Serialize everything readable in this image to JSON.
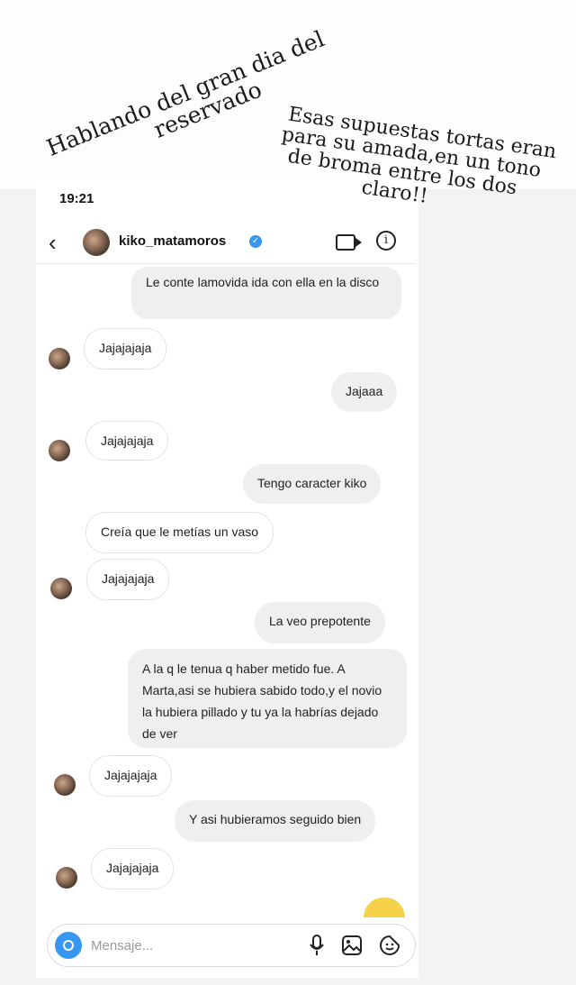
{
  "overlay": {
    "caption1": [
      "Hablando del gran dia del",
      "reservado"
    ],
    "caption2": [
      "Esas supuestas tortas eran",
      "para su amada,en un tono",
      "de broma entre los dos",
      "claro!!"
    ]
  },
  "status": {
    "time": "19:21"
  },
  "header": {
    "username": "kiko_matamoros",
    "verified_icon": "verified-check-icon",
    "video_icon": "video-camera-icon",
    "info_icon": "info-icon"
  },
  "messages": [
    {
      "from": "me",
      "text": "Le conte lamovida ida con ella en la disco"
    },
    {
      "from": "them",
      "text": "Jajajajaja"
    },
    {
      "from": "me",
      "text": "Jajaaa"
    },
    {
      "from": "them",
      "text": "Jajajajaja"
    },
    {
      "from": "me",
      "text": "Tengo caracter kiko"
    },
    {
      "from": "them",
      "text": "Creía que le metías un vaso"
    },
    {
      "from": "them",
      "text": "Jajajajaja"
    },
    {
      "from": "me",
      "text": "La veo prepotente"
    },
    {
      "from": "me",
      "text": "A la q le tenua q haber metido fue. A Marta,asi se hubiera sabido todo,y el novio la hubiera pillado y tu ya la habrías dejado de ver"
    },
    {
      "from": "them",
      "text": "Jajajajaja"
    },
    {
      "from": "me",
      "text": "Y asi hubieramos seguido bien"
    },
    {
      "from": "them",
      "text": "Jajajajaja"
    }
  ],
  "composer": {
    "placeholder": "Mensaje...",
    "icons": [
      "camera-icon",
      "microphone-icon",
      "gallery-icon",
      "sticker-icon"
    ]
  }
}
